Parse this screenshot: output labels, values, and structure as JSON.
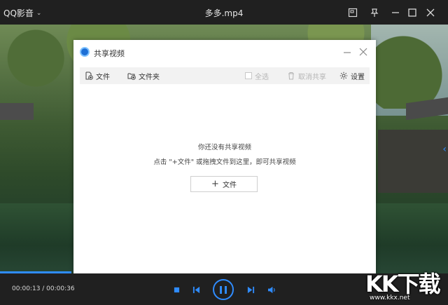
{
  "app": {
    "brand": "QQ影音",
    "file_title": "多多.mp4"
  },
  "dialog": {
    "title": "共享视频",
    "toolbar": {
      "add_file": "文件",
      "add_folder": "文件夹",
      "select_all": "全选",
      "cancel_share": "取消共享",
      "settings": "设置"
    },
    "empty_title": "你还没有共享视频",
    "empty_hint": "点击 \"+文件\" 或拖拽文件到这里，即可共享视频",
    "add_button": "文件"
  },
  "player": {
    "time": "00:00:13 / 00:00:36"
  },
  "watermark": {
    "main": "KK下载",
    "sub": "www.kkx.net"
  },
  "colors": {
    "accent": "#2f8cff",
    "bar": "#202020",
    "toolbar": "#f2f2f2"
  }
}
